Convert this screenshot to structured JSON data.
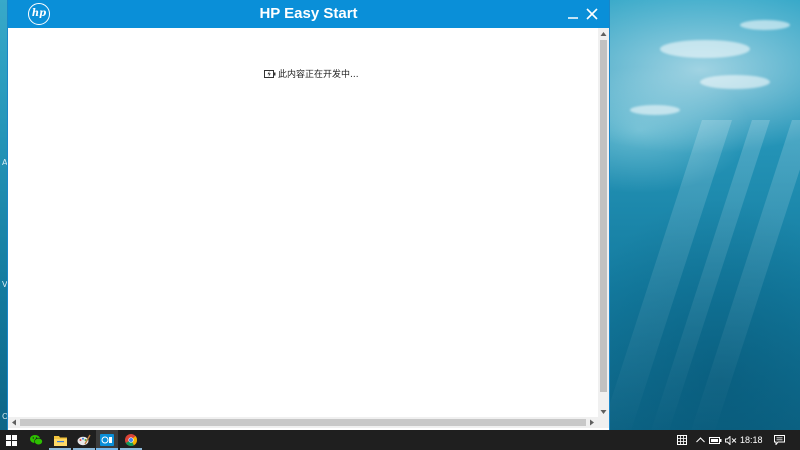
{
  "window": {
    "title": "HP Easy Start",
    "logo_text": "hp",
    "message": "此内容正在开发中..."
  },
  "taskbar": {
    "items": [
      {
        "icon": "windows-start-icon"
      },
      {
        "icon": "wechat-icon"
      },
      {
        "icon": "file-explorer-icon"
      },
      {
        "icon": "paint-icon"
      },
      {
        "icon": "hp-easy-start-icon"
      },
      {
        "icon": "chrome-icon"
      }
    ],
    "tray": {
      "icons": [
        "input-method-icon",
        "chevron-up-icon",
        "battery-icon",
        "volume-muted-icon",
        "notification-icon"
      ],
      "time": "18:18"
    }
  },
  "colors": {
    "titlebar": "#0a8fd8",
    "taskbar": "#1f1f1f",
    "accent": "#76b9ed"
  }
}
